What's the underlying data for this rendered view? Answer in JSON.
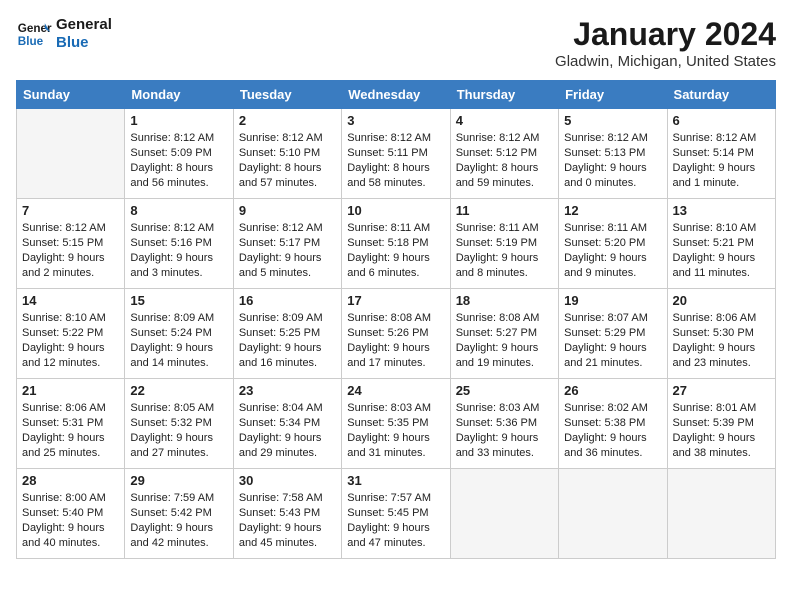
{
  "logo": {
    "general": "General",
    "blue": "Blue"
  },
  "header": {
    "month": "January 2024",
    "location": "Gladwin, Michigan, United States"
  },
  "weekdays": [
    "Sunday",
    "Monday",
    "Tuesday",
    "Wednesday",
    "Thursday",
    "Friday",
    "Saturday"
  ],
  "weeks": [
    [
      {
        "day": null,
        "sunrise": null,
        "sunset": null,
        "daylight": null
      },
      {
        "day": "1",
        "sunrise": "Sunrise: 8:12 AM",
        "sunset": "Sunset: 5:09 PM",
        "daylight": "Daylight: 8 hours and 56 minutes."
      },
      {
        "day": "2",
        "sunrise": "Sunrise: 8:12 AM",
        "sunset": "Sunset: 5:10 PM",
        "daylight": "Daylight: 8 hours and 57 minutes."
      },
      {
        "day": "3",
        "sunrise": "Sunrise: 8:12 AM",
        "sunset": "Sunset: 5:11 PM",
        "daylight": "Daylight: 8 hours and 58 minutes."
      },
      {
        "day": "4",
        "sunrise": "Sunrise: 8:12 AM",
        "sunset": "Sunset: 5:12 PM",
        "daylight": "Daylight: 8 hours and 59 minutes."
      },
      {
        "day": "5",
        "sunrise": "Sunrise: 8:12 AM",
        "sunset": "Sunset: 5:13 PM",
        "daylight": "Daylight: 9 hours and 0 minutes."
      },
      {
        "day": "6",
        "sunrise": "Sunrise: 8:12 AM",
        "sunset": "Sunset: 5:14 PM",
        "daylight": "Daylight: 9 hours and 1 minute."
      }
    ],
    [
      {
        "day": "7",
        "sunrise": "Sunrise: 8:12 AM",
        "sunset": "Sunset: 5:15 PM",
        "daylight": "Daylight: 9 hours and 2 minutes."
      },
      {
        "day": "8",
        "sunrise": "Sunrise: 8:12 AM",
        "sunset": "Sunset: 5:16 PM",
        "daylight": "Daylight: 9 hours and 3 minutes."
      },
      {
        "day": "9",
        "sunrise": "Sunrise: 8:12 AM",
        "sunset": "Sunset: 5:17 PM",
        "daylight": "Daylight: 9 hours and 5 minutes."
      },
      {
        "day": "10",
        "sunrise": "Sunrise: 8:11 AM",
        "sunset": "Sunset: 5:18 PM",
        "daylight": "Daylight: 9 hours and 6 minutes."
      },
      {
        "day": "11",
        "sunrise": "Sunrise: 8:11 AM",
        "sunset": "Sunset: 5:19 PM",
        "daylight": "Daylight: 9 hours and 8 minutes."
      },
      {
        "day": "12",
        "sunrise": "Sunrise: 8:11 AM",
        "sunset": "Sunset: 5:20 PM",
        "daylight": "Daylight: 9 hours and 9 minutes."
      },
      {
        "day": "13",
        "sunrise": "Sunrise: 8:10 AM",
        "sunset": "Sunset: 5:21 PM",
        "daylight": "Daylight: 9 hours and 11 minutes."
      }
    ],
    [
      {
        "day": "14",
        "sunrise": "Sunrise: 8:10 AM",
        "sunset": "Sunset: 5:22 PM",
        "daylight": "Daylight: 9 hours and 12 minutes."
      },
      {
        "day": "15",
        "sunrise": "Sunrise: 8:09 AM",
        "sunset": "Sunset: 5:24 PM",
        "daylight": "Daylight: 9 hours and 14 minutes."
      },
      {
        "day": "16",
        "sunrise": "Sunrise: 8:09 AM",
        "sunset": "Sunset: 5:25 PM",
        "daylight": "Daylight: 9 hours and 16 minutes."
      },
      {
        "day": "17",
        "sunrise": "Sunrise: 8:08 AM",
        "sunset": "Sunset: 5:26 PM",
        "daylight": "Daylight: 9 hours and 17 minutes."
      },
      {
        "day": "18",
        "sunrise": "Sunrise: 8:08 AM",
        "sunset": "Sunset: 5:27 PM",
        "daylight": "Daylight: 9 hours and 19 minutes."
      },
      {
        "day": "19",
        "sunrise": "Sunrise: 8:07 AM",
        "sunset": "Sunset: 5:29 PM",
        "daylight": "Daylight: 9 hours and 21 minutes."
      },
      {
        "day": "20",
        "sunrise": "Sunrise: 8:06 AM",
        "sunset": "Sunset: 5:30 PM",
        "daylight": "Daylight: 9 hours and 23 minutes."
      }
    ],
    [
      {
        "day": "21",
        "sunrise": "Sunrise: 8:06 AM",
        "sunset": "Sunset: 5:31 PM",
        "daylight": "Daylight: 9 hours and 25 minutes."
      },
      {
        "day": "22",
        "sunrise": "Sunrise: 8:05 AM",
        "sunset": "Sunset: 5:32 PM",
        "daylight": "Daylight: 9 hours and 27 minutes."
      },
      {
        "day": "23",
        "sunrise": "Sunrise: 8:04 AM",
        "sunset": "Sunset: 5:34 PM",
        "daylight": "Daylight: 9 hours and 29 minutes."
      },
      {
        "day": "24",
        "sunrise": "Sunrise: 8:03 AM",
        "sunset": "Sunset: 5:35 PM",
        "daylight": "Daylight: 9 hours and 31 minutes."
      },
      {
        "day": "25",
        "sunrise": "Sunrise: 8:03 AM",
        "sunset": "Sunset: 5:36 PM",
        "daylight": "Daylight: 9 hours and 33 minutes."
      },
      {
        "day": "26",
        "sunrise": "Sunrise: 8:02 AM",
        "sunset": "Sunset: 5:38 PM",
        "daylight": "Daylight: 9 hours and 36 minutes."
      },
      {
        "day": "27",
        "sunrise": "Sunrise: 8:01 AM",
        "sunset": "Sunset: 5:39 PM",
        "daylight": "Daylight: 9 hours and 38 minutes."
      }
    ],
    [
      {
        "day": "28",
        "sunrise": "Sunrise: 8:00 AM",
        "sunset": "Sunset: 5:40 PM",
        "daylight": "Daylight: 9 hours and 40 minutes."
      },
      {
        "day": "29",
        "sunrise": "Sunrise: 7:59 AM",
        "sunset": "Sunset: 5:42 PM",
        "daylight": "Daylight: 9 hours and 42 minutes."
      },
      {
        "day": "30",
        "sunrise": "Sunrise: 7:58 AM",
        "sunset": "Sunset: 5:43 PM",
        "daylight": "Daylight: 9 hours and 45 minutes."
      },
      {
        "day": "31",
        "sunrise": "Sunrise: 7:57 AM",
        "sunset": "Sunset: 5:45 PM",
        "daylight": "Daylight: 9 hours and 47 minutes."
      },
      {
        "day": null,
        "sunrise": null,
        "sunset": null,
        "daylight": null
      },
      {
        "day": null,
        "sunrise": null,
        "sunset": null,
        "daylight": null
      },
      {
        "day": null,
        "sunrise": null,
        "sunset": null,
        "daylight": null
      }
    ]
  ]
}
